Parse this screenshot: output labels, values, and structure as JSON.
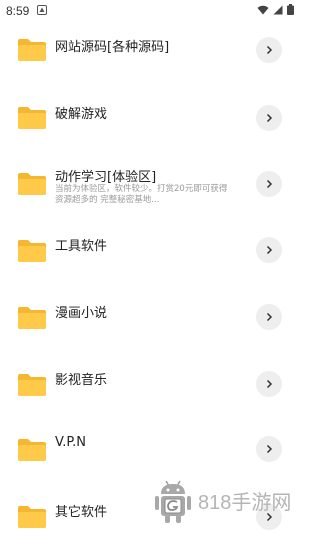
{
  "status_bar": {
    "time": "8:59"
  },
  "folders": [
    {
      "title": "网站源码[各种源码]",
      "subtitle": "",
      "icon": "folder-icon"
    },
    {
      "title": "破解游戏",
      "subtitle": "",
      "icon": "folder-icon"
    },
    {
      "title": "动作学习[体验区]",
      "subtitle": "当前为体验区，软件较少。打赏20元即可获得\n资源超多的 完整秘密基地...",
      "icon": "folder-icon"
    },
    {
      "title": "工具软件",
      "subtitle": "",
      "icon": "folder-icon"
    },
    {
      "title": "漫画小说",
      "subtitle": "",
      "icon": "folder-icon"
    },
    {
      "title": "影视音乐",
      "subtitle": "",
      "icon": "folder-icon"
    },
    {
      "title": "V.P.N",
      "subtitle": "",
      "icon": "folder-icon"
    },
    {
      "title": "其它软件",
      "subtitle": "",
      "icon": "folder-icon"
    }
  ],
  "watermark": {
    "text": "818手游网"
  },
  "colors": {
    "folder": "#FFC94A",
    "folder_dark": "#F5B731",
    "chevron_bg": "#EEEEEE",
    "subtitle": "#9A9A9A"
  }
}
